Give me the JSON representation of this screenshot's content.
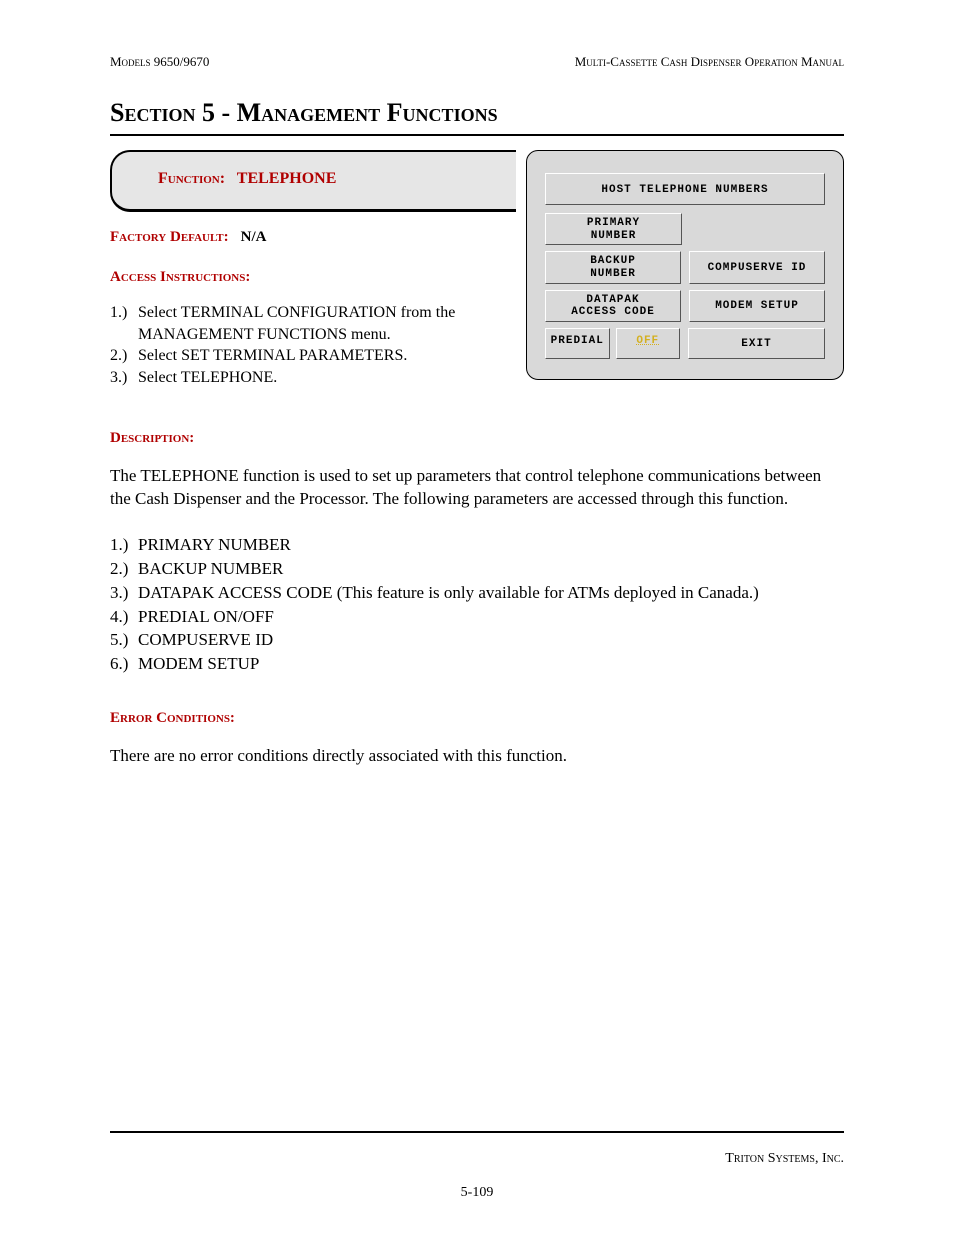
{
  "header": {
    "left": "Models 9650/9670",
    "right": "Multi-Cassette Cash Dispenser Operation Manual"
  },
  "section_title": "Section 5 - Management Functions",
  "function_box": {
    "label_prefix": "Function:",
    "label_value": "TELEPHONE"
  },
  "factory_default": {
    "label": "Factory Default:",
    "value": "N/A"
  },
  "access_instructions_label": "Access Instructions:",
  "access_instructions": [
    {
      "num": "1.)",
      "text": "Select TERMINAL CONFIGURATION from the MANAGEMENT FUNCTIONS menu."
    },
    {
      "num": "2.)",
      "text": "Select SET TERMINAL PARAMETERS."
    },
    {
      "num": "3.)",
      "text": "Select TELEPHONE."
    }
  ],
  "description_label": "Description:",
  "description_text": "The TELEPHONE function is used to set up parameters that control telephone communications between the Cash Dispenser and the Processor.  The following parameters are accessed through this function.",
  "parameters": [
    {
      "num": "1.)",
      "text": "PRIMARY NUMBER"
    },
    {
      "num": "2.)",
      "text": "BACKUP NUMBER"
    },
    {
      "num": "3.)",
      "text": "DATAPAK ACCESS CODE (This feature is only available for ATMs deployed in Canada.)"
    },
    {
      "num": "4.)",
      "text": "PREDIAL ON/OFF"
    },
    {
      "num": "5.)",
      "text": "COMPUSERVE ID"
    },
    {
      "num": "6.)",
      "text": "MODEM SETUP"
    }
  ],
  "error_conditions_label": "Error Conditions:",
  "error_conditions_text": "There are no error conditions directly associated with this function.",
  "screen": {
    "title": "HOST TELEPHONE NUMBERS",
    "row1_left_l1": "PRIMARY",
    "row1_left_l2": "NUMBER",
    "row2_left_l1": "BACKUP",
    "row2_left_l2": "NUMBER",
    "row2_right": "COMPUSERVE ID",
    "row3_left_l1": "DATAPAK",
    "row3_left_l2": "ACCESS CODE",
    "row3_right": "MODEM SETUP",
    "row4_left_a": "PREDIAL",
    "row4_left_b": "OFF",
    "row4_right": "EXIT"
  },
  "footer": {
    "company": "Triton Systems, Inc.",
    "page": "5-109"
  }
}
